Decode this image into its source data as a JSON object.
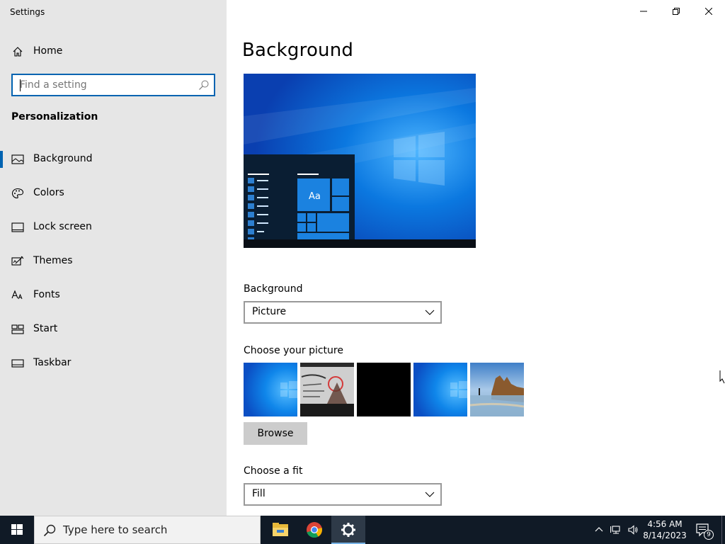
{
  "window": {
    "app_title": "Settings"
  },
  "sidebar": {
    "home_label": "Home",
    "search_placeholder": "Find a setting",
    "section_title": "Personalization",
    "items": [
      {
        "label": "Background",
        "icon": "picture-icon",
        "active": true
      },
      {
        "label": "Colors",
        "icon": "palette-icon",
        "active": false
      },
      {
        "label": "Lock screen",
        "icon": "lock-screen-icon",
        "active": false
      },
      {
        "label": "Themes",
        "icon": "themes-icon",
        "active": false
      },
      {
        "label": "Fonts",
        "icon": "fonts-icon",
        "active": false
      },
      {
        "label": "Start",
        "icon": "start-icon",
        "active": false
      },
      {
        "label": "Taskbar",
        "icon": "taskbar-icon",
        "active": false
      }
    ]
  },
  "main": {
    "title": "Background",
    "preview_sample_text": "Aa",
    "background_label": "Background",
    "background_value": "Picture",
    "choose_picture_label": "Choose your picture",
    "pictures": [
      {
        "name": "windows-blue-1"
      },
      {
        "name": "photo-banned"
      },
      {
        "name": "black"
      },
      {
        "name": "windows-blue-2"
      },
      {
        "name": "beach-rocks"
      }
    ],
    "browse_label": "Browse",
    "fit_label": "Choose a fit",
    "fit_value": "Fill"
  },
  "taskbar": {
    "search_text": "Type here to search",
    "apps": [
      "file-explorer-icon",
      "chrome-icon",
      "settings-icon"
    ],
    "clock_time": "4:56 AM",
    "clock_date": "8/14/2023",
    "notification_count": "9"
  },
  "colors": {
    "accent": "#0063b1",
    "sidebar_bg": "#e6e6e6",
    "taskbar_bg": "#101a26"
  }
}
